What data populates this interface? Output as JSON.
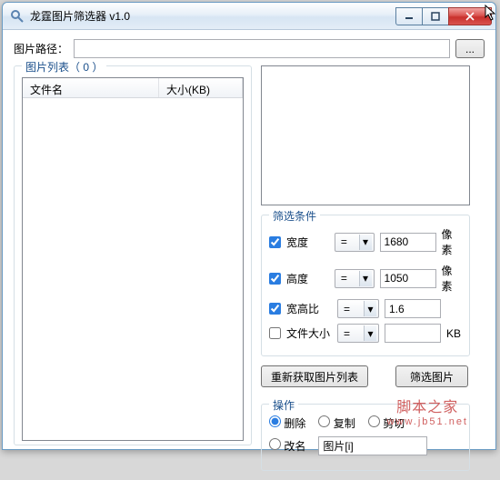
{
  "window": {
    "title": "龙霆图片筛选器 v1.0"
  },
  "path": {
    "label": "图片路径：",
    "value": ""
  },
  "list": {
    "legend_label": "图片列表",
    "count": 0,
    "legend_suffix": "（ 0 ）",
    "cols": {
      "name": "文件名",
      "size": "大小(KB)"
    }
  },
  "filter": {
    "legend": "筛选条件",
    "rows": {
      "width": {
        "checked": true,
        "label": "宽度",
        "op": "=",
        "value": "1680",
        "unit": "像素"
      },
      "height": {
        "checked": true,
        "label": "高度",
        "op": "=",
        "value": "1050",
        "unit": "像素"
      },
      "ratio": {
        "checked": true,
        "label": "宽高比",
        "op": "=",
        "value": "1.6",
        "unit": ""
      },
      "size": {
        "checked": false,
        "label": "文件大小",
        "op": "=",
        "value": "",
        "unit": "KB"
      }
    }
  },
  "buttons": {
    "refresh": "重新获取图片列表",
    "filter": "筛选图片"
  },
  "ops": {
    "legend": "操作",
    "delete": "删除",
    "copy": "复制",
    "cut": "剪切",
    "rename": "改名",
    "rename_value": "图片[i]",
    "selected": "delete"
  },
  "watermark": {
    "cn": "脚本之家",
    "url": "www.jb51.net"
  }
}
